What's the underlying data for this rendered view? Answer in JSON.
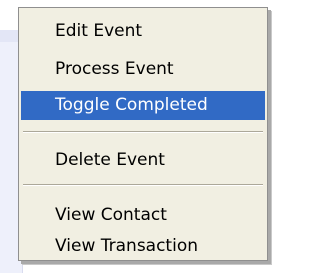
{
  "context_menu": {
    "items": [
      {
        "label": "Edit Event"
      },
      {
        "label": "Process Event"
      },
      {
        "label": "Toggle Completed",
        "selected": true
      },
      {
        "label": "Delete Event"
      },
      {
        "label": "View Contact"
      },
      {
        "label": "View Transaction"
      }
    ],
    "selection_color": "#316ac5",
    "background_color": "#f1efe2"
  }
}
